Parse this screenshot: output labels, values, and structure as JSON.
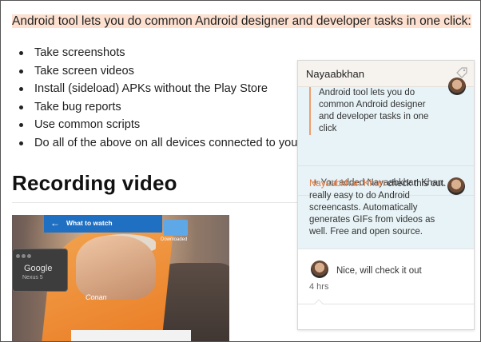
{
  "article": {
    "intro": "Android tool lets you do common Android designer and developer tasks in one click:",
    "features": [
      "Take screenshots",
      "Take screen videos",
      "Install (sideload) APKs without the Play Store",
      "Take bug reports",
      "Use common scripts",
      "Do all of the above on all devices connected to you"
    ],
    "section_heading": "Recording video"
  },
  "screenshot": {
    "app_bar_title": "What to watch",
    "device_name": "Google",
    "device_model": "Nexus 5",
    "show_title": "Conan",
    "folder_label": "Downloaded"
  },
  "comments_panel": {
    "user_name": "Nayaabkhan",
    "quoted_text": "Android tool lets you do common Android designer and developer tasks in one click",
    "added_note": "You added Nayaabkhan Khan.",
    "comment": {
      "author": "Nayaabkhan Khan",
      "text": " check this out. really easy to do Android screencasts. Automatically generates GIFs from videos as well. Free and open source."
    },
    "reply": {
      "text": "Nice, will check it out",
      "time": "4 hrs"
    }
  }
}
